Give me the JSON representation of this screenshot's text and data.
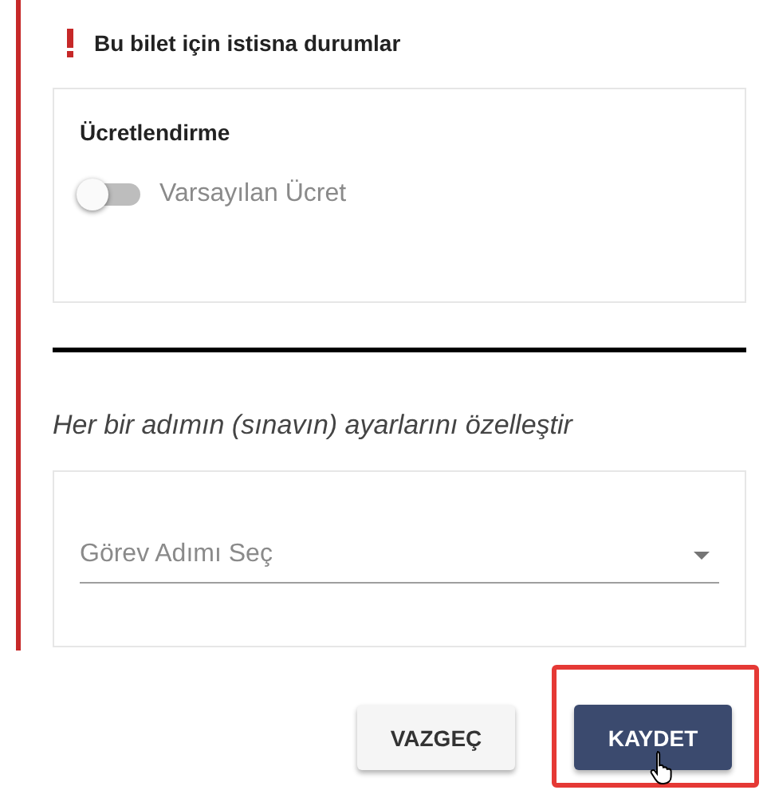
{
  "section": {
    "title": "Bu bilet için istisna durumlar"
  },
  "pricing": {
    "title": "Ücretlendirme",
    "toggle": {
      "label": "Varsayılan Ücret",
      "on": false
    }
  },
  "customize_text": "Her bir adımın (sınavın) ayarlarını özelleştir",
  "step_select": {
    "placeholder": "Görev Adımı Seç"
  },
  "buttons": [
    {
      "label": "VAZGEÇ",
      "kind": "secondary",
      "highlighted": false
    },
    {
      "label": "KAYDET",
      "kind": "primary",
      "highlighted": true
    }
  ]
}
